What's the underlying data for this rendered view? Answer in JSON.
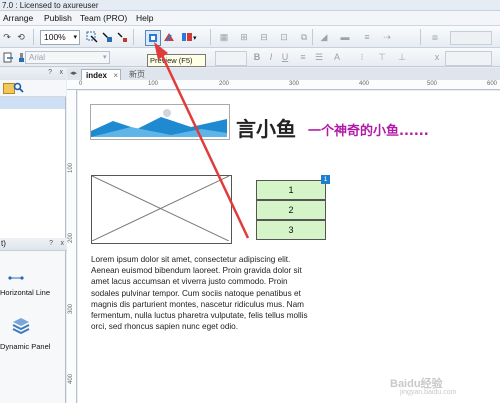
{
  "window": {
    "title": "7.0 : Licensed to axureuser"
  },
  "menu": [
    "Arrange",
    "Publish",
    "Team (PRO)",
    "Help"
  ],
  "toolbar": {
    "zoom": "100%",
    "font_placeholder": "Arial"
  },
  "tooltip": {
    "text": "Preview (F5)"
  },
  "tabs": [
    {
      "label": "index"
    },
    {
      "label": "新页"
    }
  ],
  "ruler_top": [
    "0",
    "100",
    "200",
    "300",
    "400",
    "500",
    "600"
  ],
  "ruler_left": [
    "100",
    "200",
    "300",
    "400"
  ],
  "left_bottom_panel": {
    "header": "t)",
    "widgets": [
      {
        "label": "Horizontal Line"
      },
      {
        "label": "Dynamic Panel"
      }
    ]
  },
  "canvas": {
    "heading": "言小鱼",
    "subtitle": "一个神奇的小鱼......",
    "list_items": [
      "1",
      "2",
      "3"
    ],
    "badge": "1",
    "paragraph": "Lorem ipsum dolor sit amet, consectetur adipiscing elit. Aenean euismod bibendum laoreet. Proin gravida dolor sit amet lacus accumsan et viverra justo commodo. Proin sodales pulvinar tempor. Cum sociis natoque penatibus et magnis dis parturient montes, nascetur ridiculus mus. Nam fermentum, nulla luctus pharetra vulputate, felis tellus mollis orci, sed rhoncus sapien nunc eget odio."
  },
  "watermark": {
    "text": "Baidu经验",
    "url": "jingyan.baidu.com"
  },
  "colors": {
    "accent_purple": "#b11aa6",
    "list_green": "#d5f5c8",
    "badge_blue": "#1e7fd0",
    "arrow_red": "#e23b3b"
  }
}
